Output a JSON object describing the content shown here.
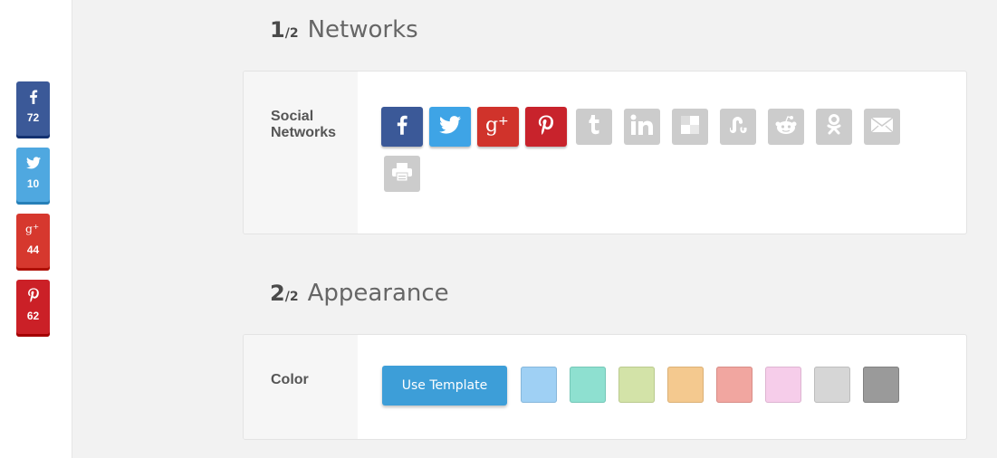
{
  "floating_share": [
    {
      "network": "facebook",
      "icon": "facebook-icon",
      "count": "72",
      "color": "#3b5998"
    },
    {
      "network": "twitter",
      "icon": "twitter-icon",
      "count": "10",
      "color": "#4fa8e0"
    },
    {
      "network": "googleplus",
      "icon": "google-plus-icon",
      "count": "44",
      "color": "#d6382e"
    },
    {
      "network": "pinterest",
      "icon": "pinterest-icon",
      "count": "62",
      "color": "#cb2027"
    }
  ],
  "section1": {
    "num": "1",
    "of": "/2",
    "title": "Networks"
  },
  "networks_card": {
    "label": "Social Networks",
    "buttons": [
      {
        "name": "facebook",
        "icon": "facebook-icon",
        "active": true,
        "color": "#3b5998"
      },
      {
        "name": "twitter",
        "icon": "twitter-icon",
        "active": true,
        "color": "#3ea4e6"
      },
      {
        "name": "googleplus",
        "icon": "google-plus-icon",
        "active": true,
        "color": "#d0332b"
      },
      {
        "name": "pinterest",
        "icon": "pinterest-icon",
        "active": true,
        "color": "#c8232c"
      },
      {
        "name": "tumblr",
        "icon": "tumblr-icon",
        "active": false
      },
      {
        "name": "linkedin",
        "icon": "linkedin-icon",
        "active": false
      },
      {
        "name": "delicious",
        "icon": "delicious-icon",
        "active": false
      },
      {
        "name": "stumbleupon",
        "icon": "stumbleupon-icon",
        "active": false
      },
      {
        "name": "reddit",
        "icon": "reddit-icon",
        "active": false
      },
      {
        "name": "odnoklassniki",
        "icon": "odnoklassniki-icon",
        "active": false
      },
      {
        "name": "email",
        "icon": "email-icon",
        "active": false
      },
      {
        "name": "print",
        "icon": "print-icon",
        "active": false
      }
    ]
  },
  "section2": {
    "num": "2",
    "of": "/2",
    "title": "Appearance"
  },
  "appearance_card": {
    "label": "Color",
    "template_button": "Use Template",
    "swatches": [
      "#9fd0f4",
      "#8ee0d0",
      "#d3e3a8",
      "#f4c98f",
      "#f1a6a0",
      "#f6cdea",
      "#d6d6d6",
      "#9a9a9a"
    ]
  }
}
